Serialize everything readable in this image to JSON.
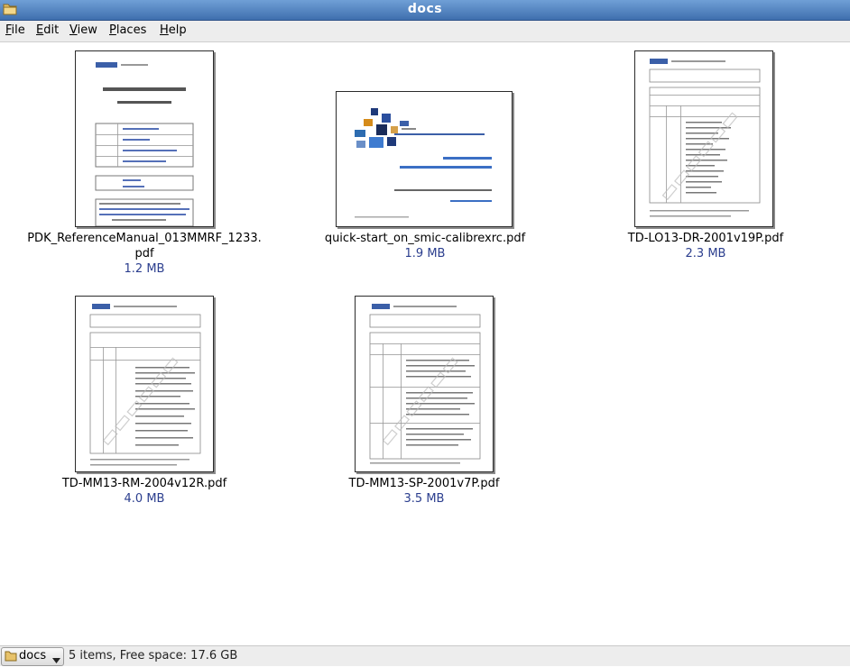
{
  "window": {
    "title": "docs"
  },
  "menubar": {
    "items": [
      {
        "label": "File",
        "mnemonic": "F",
        "rest": "ile"
      },
      {
        "label": "Edit",
        "mnemonic": "E",
        "rest": "dit"
      },
      {
        "label": "View",
        "mnemonic": "V",
        "rest": "iew"
      },
      {
        "label": "Places",
        "mnemonic": "P",
        "rest": "laces"
      },
      {
        "label": "Help",
        "mnemonic": "H",
        "rest": "elp"
      }
    ]
  },
  "files": [
    {
      "name_line1": "PDK_ReferenceManual_013MMRF_1233.",
      "name_line2": "pdf",
      "size": "1.2 MB",
      "thumb_icon": "document-thumbnail-icon",
      "thumb_text": "SMIC Process Design Kit (PDK) Reference Manual"
    },
    {
      "name_line1": "quick-start_on_smic-calibrexrc.pdf",
      "name_line2": "",
      "size": "1.9 MB",
      "thumb_icon": "presentation-thumbnail-icon",
      "thumb_text": "Quick-start on SMIC Calibre LVS - xRC Flow"
    },
    {
      "name_line1": "TD-LO13-DR-2001v19P.pdf",
      "name_line2": "",
      "size": "2.3 MB",
      "thumb_icon": "document-thumbnail-icon",
      "thumb_text": ""
    },
    {
      "name_line1": "TD-MM13-RM-2004v12R.pdf",
      "name_line2": "",
      "size": "4.0 MB",
      "thumb_icon": "document-thumbnail-icon",
      "thumb_text": ""
    },
    {
      "name_line1": "TD-MM13-SP-2001v7P.pdf",
      "name_line2": "",
      "size": "3.5 MB",
      "thumb_icon": "document-thumbnail-icon",
      "thumb_text": ""
    }
  ],
  "statusbar": {
    "path_label": "docs",
    "status": "5 items, Free space: 17.6 GB"
  },
  "colors": {
    "titlebar": "#4f7fc0",
    "filesize": "#2b3e8e",
    "menubar": "#ededed"
  }
}
